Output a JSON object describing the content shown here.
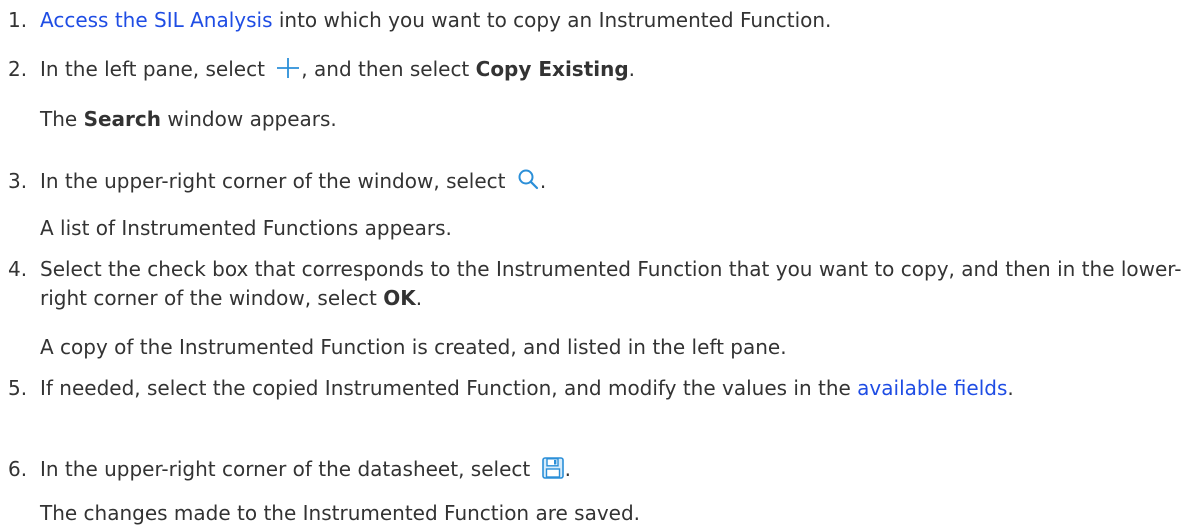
{
  "steps": [
    {
      "num": "1.",
      "link": "Access the SIL Analysis",
      "text": " into which you want to copy an Instrumented Function."
    },
    {
      "num": "2.",
      "pre": "In the left pane, select ",
      "icon": "plus-icon",
      "mid": ", and then select ",
      "bold": "Copy Existing",
      "post": ".",
      "note_bold": "Search",
      "note_text": " window appears.",
      "note_pre": "The "
    },
    {
      "num": "3.",
      "pre": "In the upper-right corner of the window, select ",
      "icon": "search-icon",
      "post": ".",
      "note": "A list of Instrumented Functions appears."
    },
    {
      "num": "4.",
      "pre": "Select the check box that corresponds to the Instrumented Function that you want to copy, and then in the lower-right corner of the window, select ",
      "bold": "OK",
      "post": ".",
      "note": "A copy of the Instrumented Function is created, and listed in the left pane."
    },
    {
      "num": "5.",
      "pre": "If needed, select the copied Instrumented Function, and modify the values in the ",
      "link": "available fields",
      "post": "."
    },
    {
      "num": "6.",
      "pre": "In the upper-right corner of the datasheet, select ",
      "icon": "save-icon",
      "post": ".",
      "note": "The changes made to the Instrumented Function are saved."
    }
  ],
  "colors": {
    "text": "#333333",
    "link": "#1f4de4",
    "icon": "#2b8fd8"
  }
}
